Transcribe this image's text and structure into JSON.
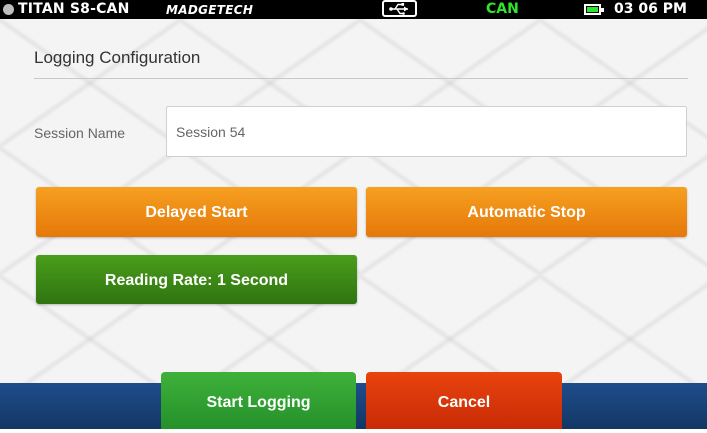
{
  "status_bar": {
    "device_name": "TITAN S8-CAN",
    "brand": "MADGETECH",
    "connection_icon": "usb-icon",
    "bus_label": "CAN",
    "battery_icon": "battery-icon",
    "time": "03 06 PM",
    "bus_color": "#2be62b"
  },
  "page": {
    "title": "Logging Configuration"
  },
  "session": {
    "label": "Session Name",
    "value": "Session 54"
  },
  "options": {
    "delayed_start_label": "Delayed Start",
    "automatic_stop_label": "Automatic Stop",
    "reading_rate_label": "Reading Rate: 1 Second"
  },
  "footer": {
    "start_label": "Start Logging",
    "cancel_label": "Cancel"
  },
  "colors": {
    "orange_button": "#ee8c15",
    "green_button": "#3d8a17",
    "start_button": "#32a233",
    "cancel_button": "#d8380a",
    "footer_bar": "#1a4479"
  }
}
